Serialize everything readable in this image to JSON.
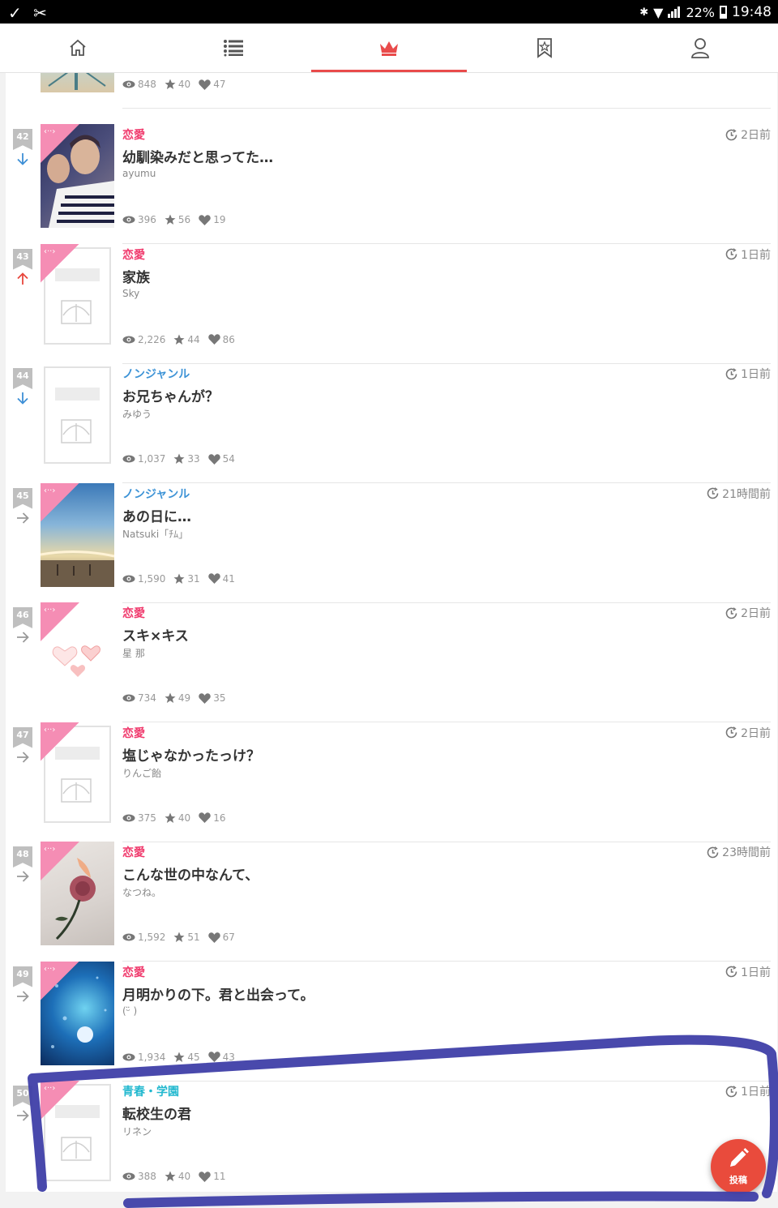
{
  "status_bar": {
    "left_icons": [
      "check-icon",
      "tools-icon"
    ],
    "battery": "22%",
    "time": "19:48"
  },
  "nav": {
    "tabs": [
      {
        "name": "home",
        "icon": "home-icon",
        "active": false
      },
      {
        "name": "list",
        "icon": "list-icon",
        "active": false
      },
      {
        "name": "ranking",
        "icon": "crown-icon",
        "active": true
      },
      {
        "name": "bookmark",
        "icon": "bookmark-star-icon",
        "active": false
      },
      {
        "name": "profile",
        "icon": "user-icon",
        "active": false
      }
    ],
    "accent": "#e94b4b"
  },
  "partial_item": {
    "views": "848",
    "stars": "40",
    "likes": "47"
  },
  "items": [
    {
      "rank": "42",
      "trend": "down",
      "genre": "恋愛",
      "genre_color": "#f0386b",
      "title": "幼馴染みだと思ってた…",
      "author": "ayumu",
      "time": "2日前",
      "views": "396",
      "stars": "56",
      "likes": "19",
      "cover": "photo-boys"
    },
    {
      "rank": "43",
      "trend": "up",
      "genre": "恋愛",
      "genre_color": "#f0386b",
      "title": "家族",
      "author": "Sky",
      "time": "1日前",
      "views": "2,226",
      "stars": "44",
      "likes": "86",
      "cover": "blank-ribbon"
    },
    {
      "rank": "44",
      "trend": "down",
      "genre": "ノンジャンル",
      "genre_color": "#3d93d6",
      "title": "お兄ちゃんが？",
      "author": "みゆう",
      "time": "1日前",
      "views": "1,037",
      "stars": "33",
      "likes": "54",
      "cover": "blank"
    },
    {
      "rank": "45",
      "trend": "same",
      "genre": "ノンジャンル",
      "genre_color": "#3d93d6",
      "title": "あの日に…",
      "author": "Natsuki「ﾁﾑ」",
      "time": "21時間前",
      "views": "1,590",
      "stars": "31",
      "likes": "41",
      "cover": "photo-sky"
    },
    {
      "rank": "46",
      "trend": "same",
      "genre": "恋愛",
      "genre_color": "#f0386b",
      "title": "スキ×キス",
      "author": "星 那",
      "time": "2日前",
      "views": "734",
      "stars": "49",
      "likes": "35",
      "cover": "hearts"
    },
    {
      "rank": "47",
      "trend": "same",
      "genre": "恋愛",
      "genre_color": "#f0386b",
      "title": "塩じゃなかったっけ？",
      "author": "りんご飴",
      "time": "2日前",
      "views": "375",
      "stars": "40",
      "likes": "16",
      "cover": "blank-ribbon"
    },
    {
      "rank": "48",
      "trend": "same",
      "genre": "恋愛",
      "genre_color": "#f0386b",
      "title": "こんな世の中なんて、",
      "author": "なつね。",
      "time": "23時間前",
      "views": "1,592",
      "stars": "51",
      "likes": "67",
      "cover": "photo-rose"
    },
    {
      "rank": "49",
      "trend": "same",
      "genre": "恋愛",
      "genre_color": "#f0386b",
      "title": "月明かりの下。君と出会って。",
      "author": "(ᵕ̈ )",
      "time": "1日前",
      "views": "1,934",
      "stars": "45",
      "likes": "43",
      "cover": "photo-moon"
    },
    {
      "rank": "50",
      "trend": "same",
      "genre": "青春・学園",
      "genre_color": "#22b8cf",
      "title": "転校生の君",
      "author": "リネン",
      "time": "1日前",
      "views": "388",
      "stars": "40",
      "likes": "11",
      "cover": "blank-ribbon"
    }
  ],
  "fab": {
    "label": "投稿",
    "icon": "pencil-icon"
  }
}
